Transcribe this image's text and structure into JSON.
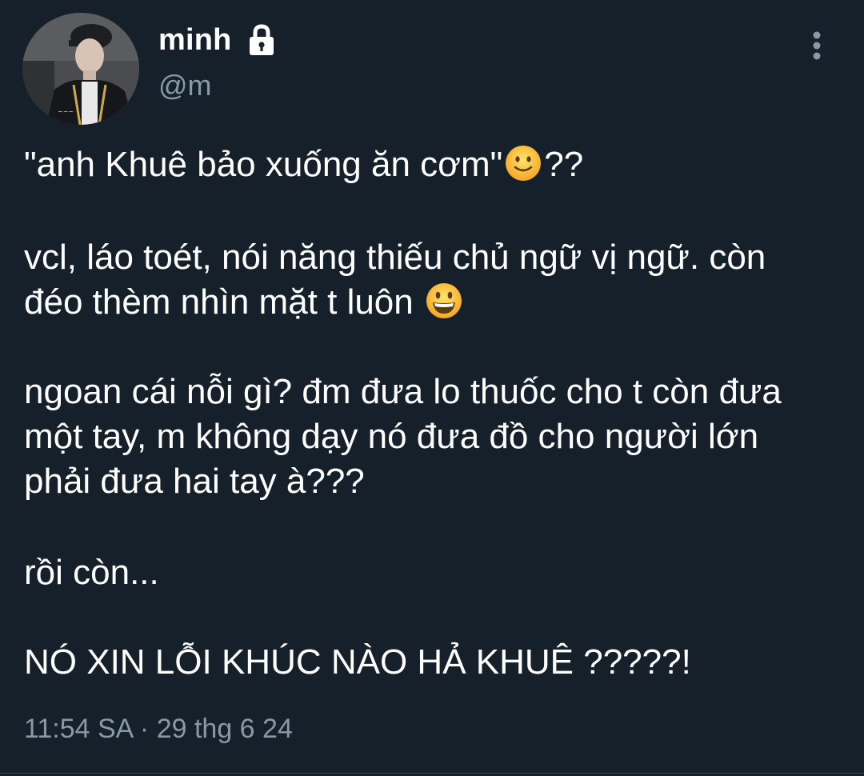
{
  "user": {
    "display_name": "minh",
    "handle": "@m",
    "avatar_icon": "avatar-photo",
    "protected_icon": "lock-icon"
  },
  "tweet": {
    "line1_before": "\"anh Khuê bảo xuống ăn cơm\"",
    "line1_emoji": "slightly-smiling-face",
    "line1_after": "??",
    "line2a": "vcl, láo toét, nói năng thiếu chủ ngữ vị ngữ. còn",
    "line2b_before": "đéo thèm nhìn mặt t luôn ",
    "line2b_emoji": "grinning-face",
    "line3a": "ngoan cái nỗi gì? đm đưa lo thuốc cho t còn đưa",
    "line3b": "một tay, m không dạy nó đưa đồ cho người lớn",
    "line3c": "phải đưa hai tay à???",
    "line4": "rồi còn...",
    "line5": "NÓ XIN LỖI KHÚC NÀO HẢ KHUÊ ?????!"
  },
  "meta": {
    "timestamp": "11:54 SA · 29 thg 6 24"
  },
  "colors": {
    "background": "#15202b",
    "text": "#ffffff",
    "secondary": "#8899a6"
  }
}
